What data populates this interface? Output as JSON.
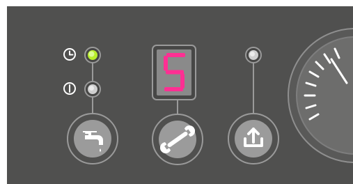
{
  "panel": {
    "background_color": "#50504f",
    "accent_outline": "#9a9a9a",
    "button_fill": "#9b9b9b",
    "icon_color": "#ffffff"
  },
  "indicators": {
    "timer_mode": {
      "icon": "clock-icon",
      "led_state": "on",
      "led_color": "#b9ef2a"
    },
    "continuous_mode": {
      "icon": "power-on-icon",
      "led_state": "off",
      "led_color": "#cfcfcf"
    },
    "reset": {
      "led_state": "off",
      "led_color": "#cfcfcf"
    }
  },
  "display": {
    "value": "5",
    "segment_color": "#ff2f93"
  },
  "buttons": {
    "hot_water": {
      "icon": "water-tap-icon"
    },
    "service": {
      "icon": "wrench-icon"
    },
    "reset": {
      "icon": "reset-arrow-icon"
    }
  },
  "dial": {
    "icon": "temperature-dial"
  }
}
